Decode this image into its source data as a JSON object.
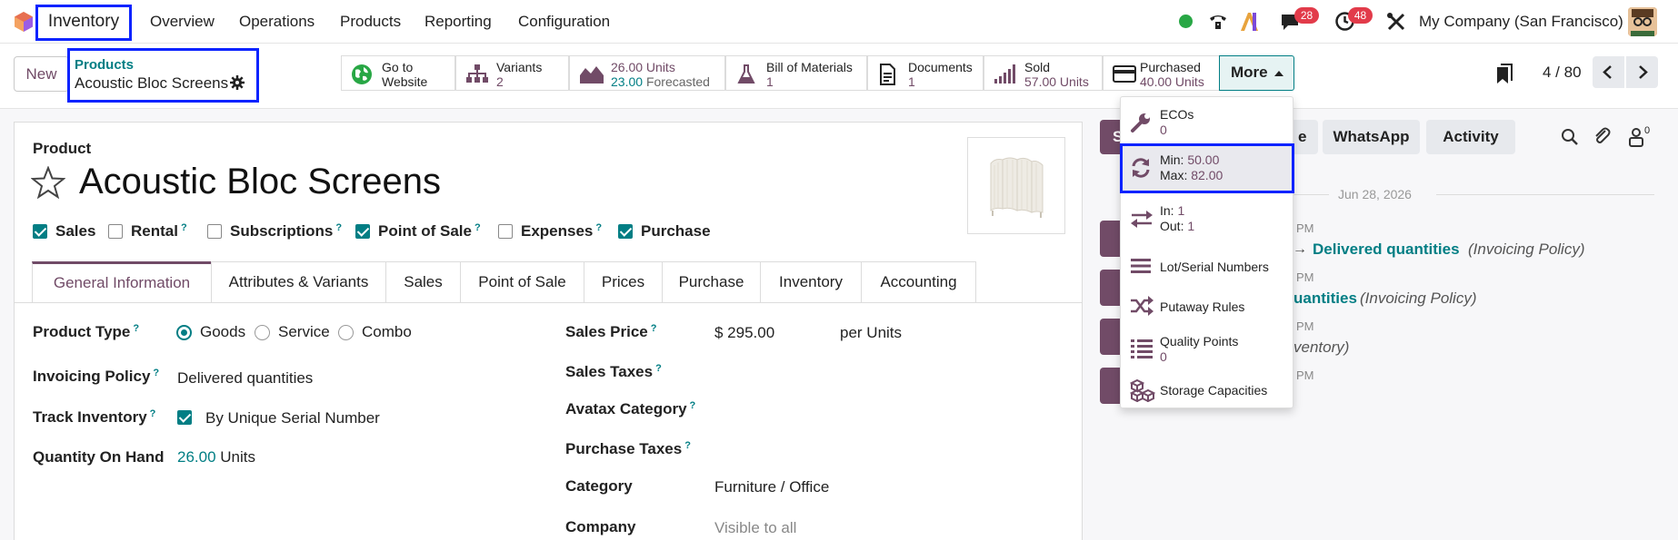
{
  "navbar": {
    "app_name": "Inventory",
    "menus": [
      "Overview",
      "Operations",
      "Products",
      "Reporting",
      "Configuration"
    ],
    "chat_badge": "28",
    "activity_badge": "48",
    "company": "My Company (San Francisco)"
  },
  "breadcrumb": {
    "parent": "Products",
    "current": "Acoustic Bloc Screens"
  },
  "control_panel": {
    "new_label": "New",
    "pager": "4 / 80",
    "smart_buttons": {
      "website": {
        "line1": "Go to",
        "line2": "Website"
      },
      "variants": {
        "label": "Variants",
        "value": "2"
      },
      "forecast": {
        "line1": "26.00 Units",
        "line2_value": "23.00",
        "line2_label": "Forecasted"
      },
      "bom": {
        "label": "Bill of Materials",
        "value": "1"
      },
      "documents": {
        "label": "Documents",
        "value": "1"
      },
      "sold": {
        "label": "Sold",
        "value": "57.00 Units"
      },
      "purchased": {
        "label": "Purchased",
        "value": "40.00 Units"
      },
      "more": "More"
    }
  },
  "more_menu": {
    "ecos": {
      "label": "ECOs",
      "value": "0"
    },
    "minmax": {
      "min_label": "Min:",
      "min_value": "50.00",
      "max_label": "Max:",
      "max_value": "82.00"
    },
    "inout": {
      "in_label": "In:",
      "in_value": "1",
      "out_label": "Out:",
      "out_value": "1"
    },
    "lots": "Lot/Serial Numbers",
    "putaway": "Putaway Rules",
    "quality": {
      "label": "Quality Points",
      "value": "0"
    },
    "storage": "Storage Capacities"
  },
  "form": {
    "product_label": "Product",
    "name": "Acoustic Bloc Screens",
    "checkboxes": [
      {
        "label": "Sales",
        "checked": true,
        "help": false
      },
      {
        "label": "Rental",
        "checked": false,
        "help": true
      },
      {
        "label": "Subscriptions",
        "checked": false,
        "help": true
      },
      {
        "label": "Point of Sale",
        "checked": true,
        "help": true
      },
      {
        "label": "Expenses",
        "checked": false,
        "help": true
      },
      {
        "label": "Purchase",
        "checked": true,
        "help": false
      }
    ],
    "tabs": [
      "General Information",
      "Attributes & Variants",
      "Sales",
      "Point of Sale",
      "Prices",
      "Purchase",
      "Inventory",
      "Accounting"
    ],
    "fields": {
      "product_type_label": "Product Type",
      "product_type_options": [
        "Goods",
        "Service",
        "Combo"
      ],
      "invoicing_policy_label": "Invoicing Policy",
      "invoicing_policy": "Delivered quantities",
      "track_inventory_label": "Track Inventory",
      "track_inventory": "By Unique Serial Number",
      "qty_on_hand_label": "Quantity On Hand",
      "qty_on_hand": "26.00",
      "qty_unit": "Units",
      "sales_price_label": "Sales Price",
      "sales_price": "$ 295.00",
      "sales_price_unit": "per Units",
      "sales_taxes_label": "Sales Taxes",
      "avatax_label": "Avatax Category",
      "purchase_taxes_label": "Purchase Taxes",
      "category_label": "Category",
      "category": "Furniture / Office",
      "company_label": "Company",
      "company_placeholder": "Visible to all"
    }
  },
  "chatter": {
    "send_partial": "S",
    "log_partial": "e",
    "whatsapp": "WhatsApp",
    "activity": "Activity",
    "followers_count": "0",
    "date": "Jun 28, 2026",
    "msg1_time": "PM",
    "msg1_new": "Delivered quantities",
    "msg1_field": "(Invoicing Policy)",
    "msg2_time": "PM",
    "msg2_new": "uantities",
    "msg2_field": "(Invoicing Policy)",
    "msg3_time": "PM",
    "msg3_field": "ventory)",
    "msg4_time": "PM"
  },
  "colors": {
    "brand": "#714b67",
    "accent": "#017e84",
    "highlight": "#0a23ff",
    "badge": "#e23b4a"
  }
}
